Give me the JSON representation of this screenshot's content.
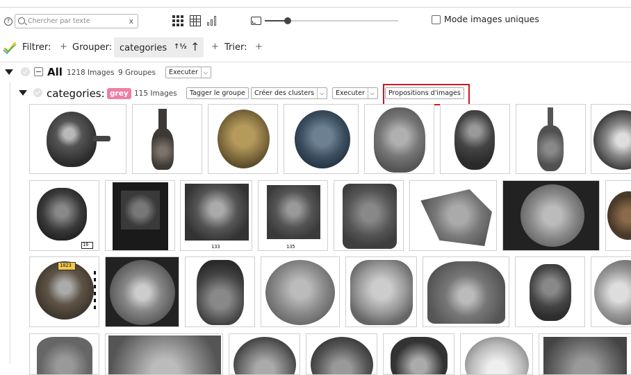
{
  "toolbar": {
    "help": "?",
    "search_placeholder": "Chercher par texte",
    "search_clear": "x",
    "slider_fraction": 0.17,
    "unique_images_label": "Mode images uniques"
  },
  "controls": {
    "filter_label": "Filtrer:",
    "group_label": "Grouper:",
    "group_value": "categories",
    "sort_az": "↑½",
    "sort_dir": "↑",
    "sort_label": "Trier:",
    "plus": "+"
  },
  "all_group": {
    "title": "All",
    "images": "1218 Images",
    "groups": "9 Groupes",
    "execute": "Executer"
  },
  "category_group": {
    "title": "categories:",
    "tag": "grey",
    "tag_color": "#ee7ea6",
    "images": "115 Images",
    "tag_group": "Tagger le groupe",
    "create_clusters": "Créer des clusters",
    "execute": "Executer",
    "proposals": "Propositions d'images"
  },
  "labels": {
    "dd": "⌵",
    "n16": "16",
    "n133": "133",
    "n135": "135",
    "n1023": "1023"
  },
  "colors": {
    "highlight": "#d0161f",
    "accent_check": "#f2b705"
  }
}
